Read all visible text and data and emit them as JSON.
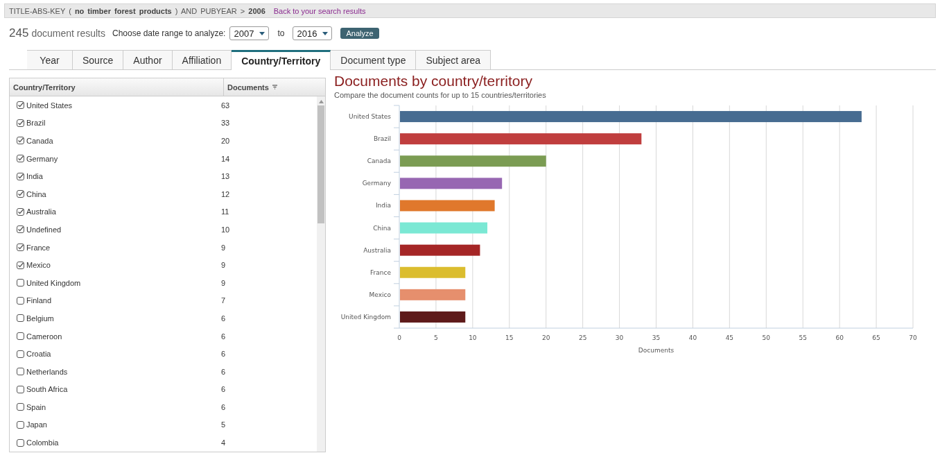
{
  "query": {
    "text": "TITLE-ABS-KEY ( **no timber forest products** ) AND PUBYEAR > **2006**",
    "back_link": "Back to your search results"
  },
  "results": {
    "count": "245",
    "label": "document results",
    "range_label": "Choose date range to analyze:",
    "from": "2007",
    "to_label": "to",
    "to": "2016",
    "button": "Analyze"
  },
  "tabs": [
    {
      "label": "Year",
      "selected": false
    },
    {
      "label": "Source",
      "selected": false
    },
    {
      "label": "Author",
      "selected": false
    },
    {
      "label": "Affiliation",
      "selected": false
    },
    {
      "label": "Country/Territory",
      "selected": true
    },
    {
      "label": "Document type",
      "selected": false
    },
    {
      "label": "Subject area",
      "selected": false
    }
  ],
  "table": {
    "columns": [
      "Country/Territory",
      "Documents"
    ],
    "rows": [
      {
        "name": "United States",
        "count": "63",
        "checked": true
      },
      {
        "name": "Brazil",
        "count": "33",
        "checked": true
      },
      {
        "name": "Canada",
        "count": "20",
        "checked": true
      },
      {
        "name": "Germany",
        "count": "14",
        "checked": true
      },
      {
        "name": "India",
        "count": "13",
        "checked": true
      },
      {
        "name": "China",
        "count": "12",
        "checked": true
      },
      {
        "name": "Australia",
        "count": "11",
        "checked": true
      },
      {
        "name": "Undefined",
        "count": "10",
        "checked": true
      },
      {
        "name": "France",
        "count": "9",
        "checked": true
      },
      {
        "name": "Mexico",
        "count": "9",
        "checked": true
      },
      {
        "name": "United Kingdom",
        "count": "9",
        "checked": false
      },
      {
        "name": "Finland",
        "count": "7",
        "checked": false
      },
      {
        "name": "Belgium",
        "count": "6",
        "checked": false
      },
      {
        "name": "Cameroon",
        "count": "6",
        "checked": false
      },
      {
        "name": "Croatia",
        "count": "6",
        "checked": false
      },
      {
        "name": "Netherlands",
        "count": "6",
        "checked": false
      },
      {
        "name": "South Africa",
        "count": "6",
        "checked": false
      },
      {
        "name": "Spain",
        "count": "6",
        "checked": false
      },
      {
        "name": "Japan",
        "count": "5",
        "checked": false
      },
      {
        "name": "Colombia",
        "count": "4",
        "checked": false
      }
    ]
  },
  "chart": {
    "heading": "Documents by country/territory",
    "subtitle": "Compare the document counts for up to 15 countries/territories",
    "chart_data": {
      "type": "bar",
      "orientation": "horizontal",
      "xlabel": "Documents",
      "categories": [
        "United States",
        "Brazil",
        "Canada",
        "Germany",
        "India",
        "China",
        "Australia",
        "France",
        "Mexico",
        "United Kingdom"
      ],
      "values": [
        63,
        33,
        20,
        14,
        13,
        12,
        11,
        9,
        9,
        9
      ],
      "grid": true,
      "colors": [
        "#476c91",
        "#c03e3e",
        "#7b9c53",
        "#9767b2",
        "#e0782c",
        "#7be8d4",
        "#a52626",
        "#dbbd2e",
        "#e68f6d",
        "#5e1a1a"
      ],
      "xlim": [
        0,
        70
      ],
      "xticks": [
        0,
        5,
        10,
        15,
        20,
        25,
        30,
        35,
        40,
        45,
        50,
        55,
        60,
        65,
        70
      ]
    }
  }
}
